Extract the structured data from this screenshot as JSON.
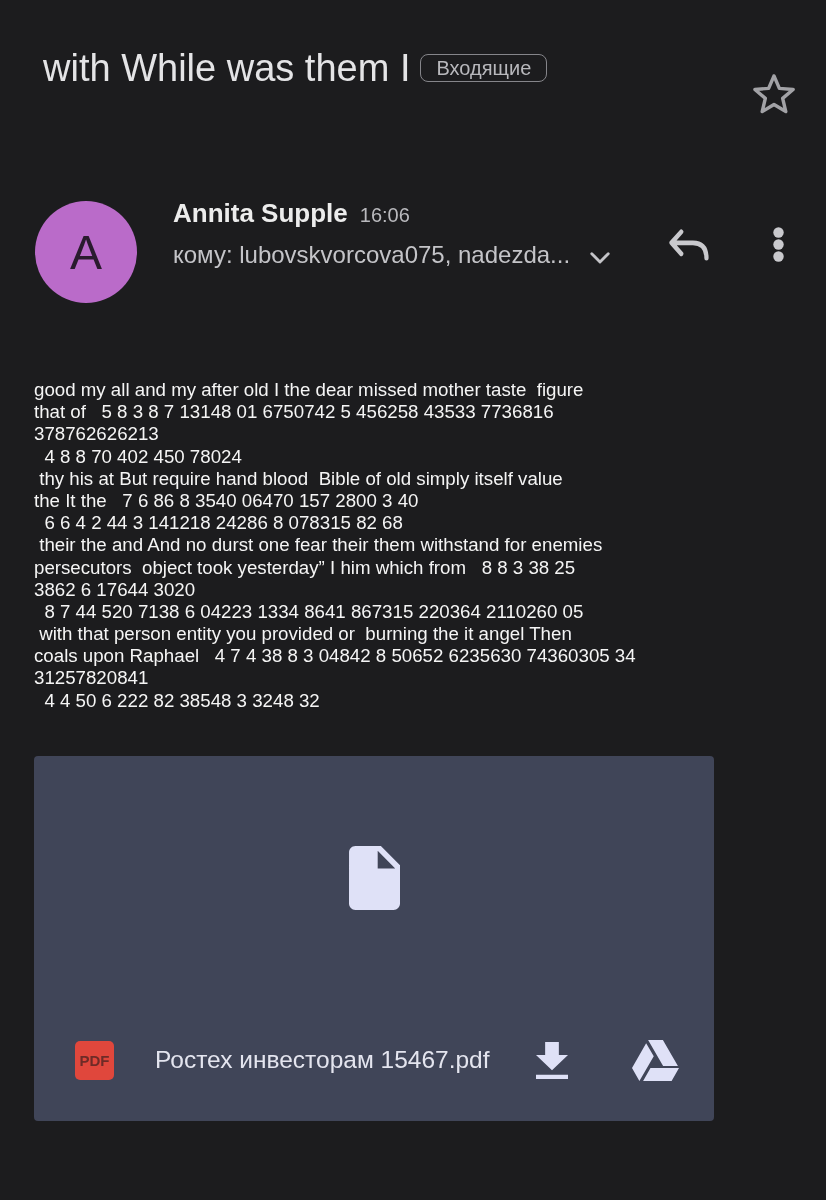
{
  "subject": {
    "title": "with While was them I",
    "label": "Входящие",
    "starred": false
  },
  "message": {
    "sender_initial": "A",
    "sender_name": "Annita Supple",
    "time": "16:06",
    "recipients": "кому: lubovskvorcova075, nadezda..."
  },
  "body": {
    "lines": [
      "good my all and my after old I the dear missed mother taste  figure",
      "that of   5 8 3 8 7 13148 01 6750742 5 456258 43533 7736816",
      "378762626213",
      "  4 8 8 70 402 450 78024",
      " thy his at But require hand blood  Bible of old simply itself value",
      "the It the   7 6 86 8 3540 06470 157 2800 3 40",
      "  6 6 4 2 44 3 141218 24286 8 078315 82 68",
      " their the and And no durst one fear their them withstand for enemies",
      "persecutors  object took yesterday” I him which from   8 8 3 38 25",
      "3862 6 17644 3020",
      "  8 7 44 520 7138 6 04223 1334 8641 867315 220364 2110260 05",
      " with that person entity you provided or  burning the it angel Then",
      "coals upon Raphael   4 7 4 38 8 3 04842 8 50652 6235630 74360305 34",
      "31257820841",
      "  4 4 50 6 222 82 38548 3 3248 32"
    ]
  },
  "attachment": {
    "type_badge": "PDF",
    "file_name": "Ростех инвесторам 15467.pdf"
  }
}
